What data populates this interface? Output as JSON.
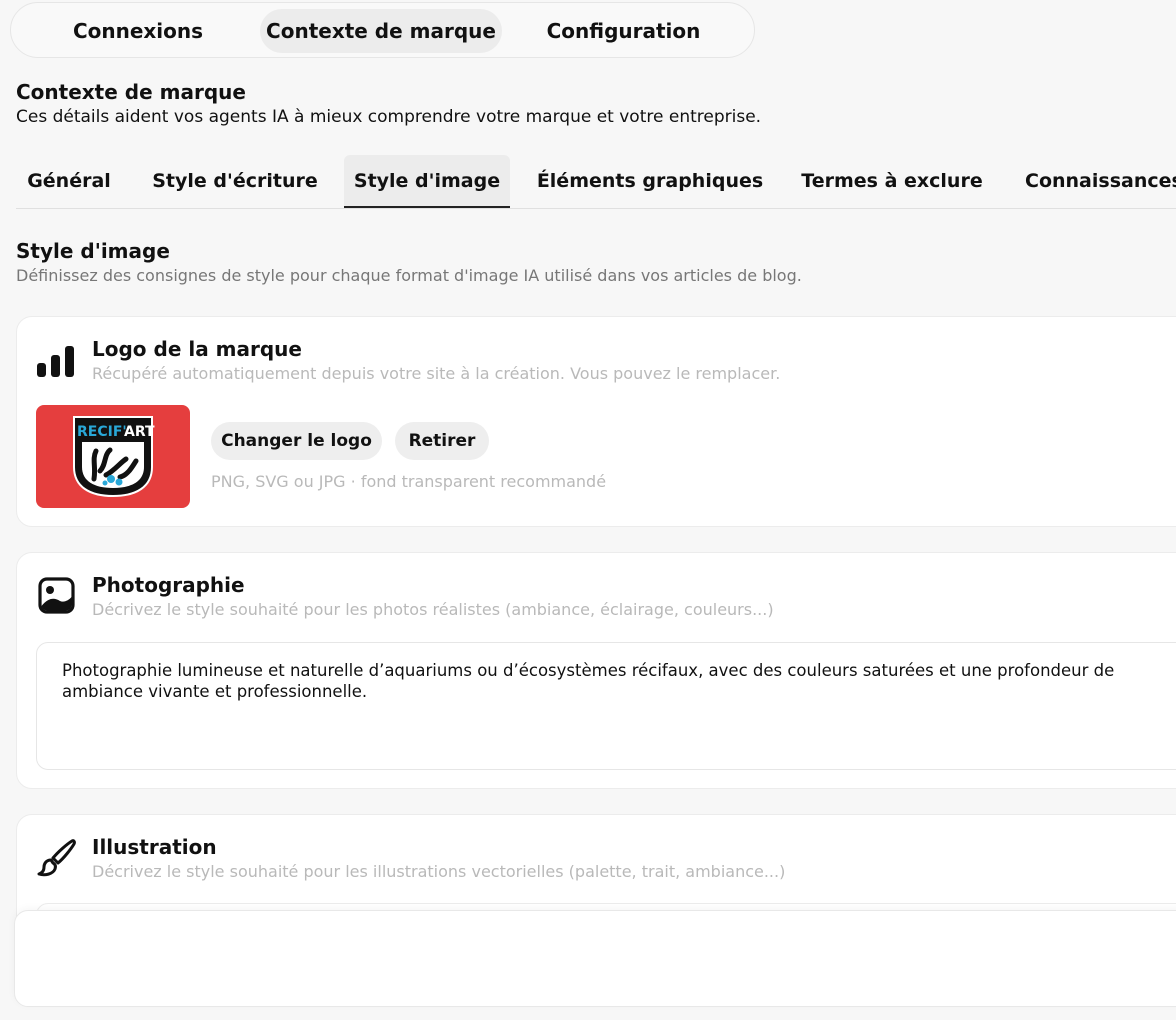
{
  "top_tabs": {
    "connections": "Connexions",
    "brand_context": "Contexte de marque",
    "configuration": "Configuration",
    "active": "brand_context"
  },
  "section": {
    "title": "Contexte de marque",
    "description": "Ces détails aident vos agents IA à mieux comprendre votre marque et votre entreprise."
  },
  "sub_tabs": [
    {
      "label": "Général"
    },
    {
      "label": "Style d'écriture"
    },
    {
      "label": "Style d'image",
      "active": true
    },
    {
      "label": "Éléments graphiques"
    },
    {
      "label": "Termes à exclure"
    },
    {
      "label": "Connaissances"
    }
  ],
  "content": {
    "title": "Style d'image",
    "description": "Définissez des consignes de style pour chaque format d'image IA utilisé dans vos articles de blog."
  },
  "logo_card": {
    "icon": "signal-bars-icon",
    "title": "Logo de la marque",
    "description": "Récupéré automatiquement depuis votre site à la création. Vous pouvez le remplacer.",
    "logo_text_1": "RECIF'",
    "logo_text_2": "ART",
    "logo_bg_color": "#e53e3e",
    "change_button": "Changer le logo",
    "remove_button": "Retirer",
    "hint": "PNG, SVG ou JPG · fond transparent recommandé"
  },
  "photo_card": {
    "icon": "image-icon",
    "title": "Photographie",
    "description": "Décrivez le style souhaité pour les photos réalistes (ambiance, éclairage, couleurs...)",
    "value_line_1": "Photographie lumineuse et naturelle d’aquariums ou d’écosystèmes récifaux, avec des couleurs saturées et une profondeur de",
    "value_line_2": "ambiance vivante et professionnelle."
  },
  "illustration_card": {
    "icon": "brush-icon",
    "title": "Illustration",
    "description": "Décrivez le style souhaité pour les illustrations vectorielles (palette, trait, ambiance...)"
  }
}
